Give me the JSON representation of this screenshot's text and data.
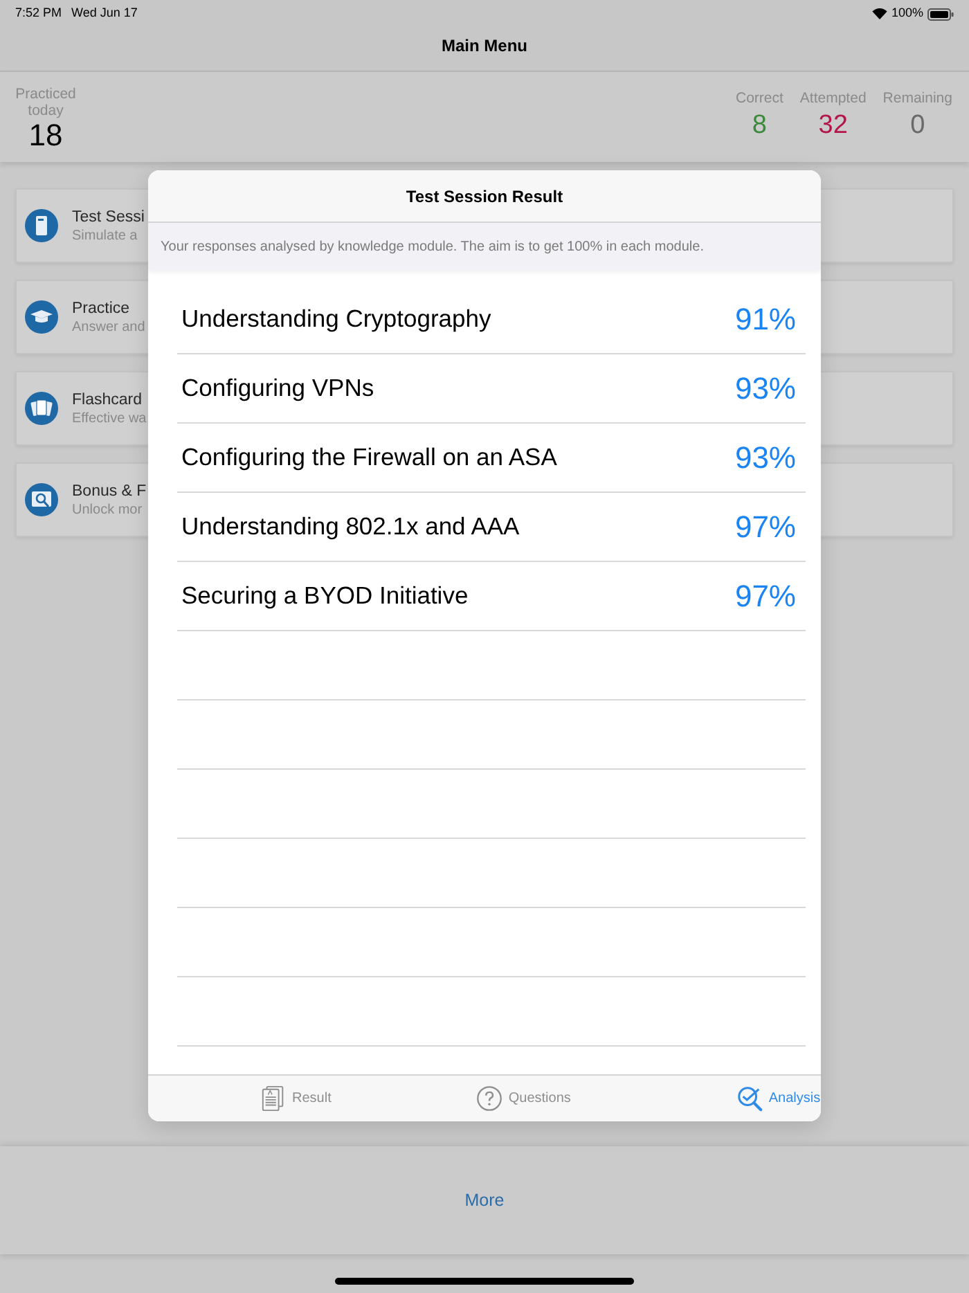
{
  "status_bar": {
    "time": "7:52 PM",
    "date": "Wed Jun 17",
    "battery": "100%"
  },
  "nav_bar": {
    "title": "Main Menu"
  },
  "stats": {
    "practiced": {
      "label": "Practiced today",
      "value": "18"
    },
    "scores": [
      {
        "label": "Correct",
        "value": "8",
        "color": "#3b8a3b"
      },
      {
        "label": "Attempted",
        "value": "32",
        "color": "#b3164a"
      },
      {
        "label": "Remaining",
        "value": "0",
        "color": "#6a6a6a"
      }
    ]
  },
  "menu_items": [
    {
      "title": "Test Sessi",
      "subtitle": "Simulate a"
    },
    {
      "title": "Practice",
      "subtitle": "Answer and"
    },
    {
      "title": "Flashcard",
      "subtitle": "Effective wa"
    },
    {
      "title": "Bonus & F",
      "subtitle": "Unlock mor"
    }
  ],
  "dialog": {
    "title": "Test Session Result",
    "note": "Your responses analysed by knowledge module. The aim is to get 100% in each module.",
    "modules": [
      {
        "name": "Understanding Cryptography",
        "score": "91%"
      },
      {
        "name": "Configuring VPNs",
        "score": "93%"
      },
      {
        "name": "Configuring the Firewall on an ASA",
        "score": "93%"
      },
      {
        "name": "Understanding 802.1x and AAA",
        "score": "97%"
      },
      {
        "name": "Securing a BYOD Initiative",
        "score": "97%"
      }
    ],
    "tabs": [
      {
        "label": "Result",
        "selected": false
      },
      {
        "label": "Questions",
        "selected": false
      },
      {
        "label": "Analysis",
        "selected": true
      }
    ]
  },
  "more_button": {
    "label": "More"
  }
}
